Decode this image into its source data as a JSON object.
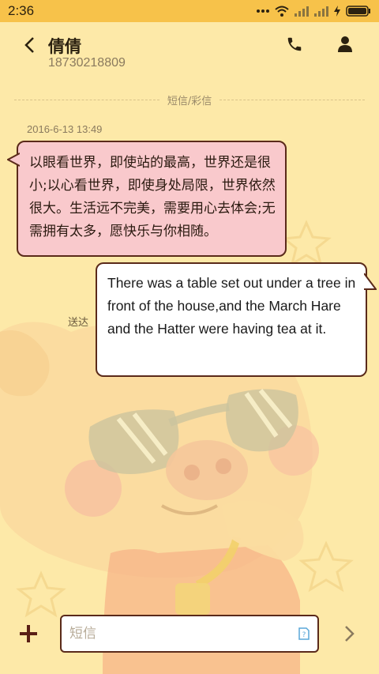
{
  "status_bar": {
    "time": "2:36",
    "icons": [
      "more-dots-icon",
      "wifi-icon",
      "signal-icon-1",
      "signal-icon-2",
      "charging-icon",
      "battery-icon"
    ]
  },
  "header": {
    "contact_name": "倩倩",
    "contact_number": "18730218809",
    "back_icon": "chevron-left-icon",
    "call_icon": "phone-icon",
    "profile_icon": "person-icon"
  },
  "conversation": {
    "divider_label": "短信/彩信",
    "timestamp": "2016-6-13 13:49",
    "messages": [
      {
        "direction": "incoming",
        "text": "以眼看世界，即使站的最高，世界还是很小;以心看世界，即使身处局限，世界依然很大。生活远不完美，需要用心去体会;无需拥有太多，愿快乐与你相随。"
      },
      {
        "direction": "outgoing",
        "text": "There was a table set out under a tree in front of the house,and the March Hare and the Hatter were having tea at it.",
        "status": "送达"
      }
    ]
  },
  "compose": {
    "placeholder": "短信",
    "value": "",
    "add_icon": "plus-icon",
    "send_icon": "chevron-right-icon",
    "sim_icon": "sim-card-icon"
  },
  "colors": {
    "background": "#fde9a8",
    "status_bar": "#f7c24a",
    "incoming_bubble": "#f9c9cc",
    "outgoing_bubble": "#ffffff",
    "bubble_border": "#5a2a1a"
  }
}
